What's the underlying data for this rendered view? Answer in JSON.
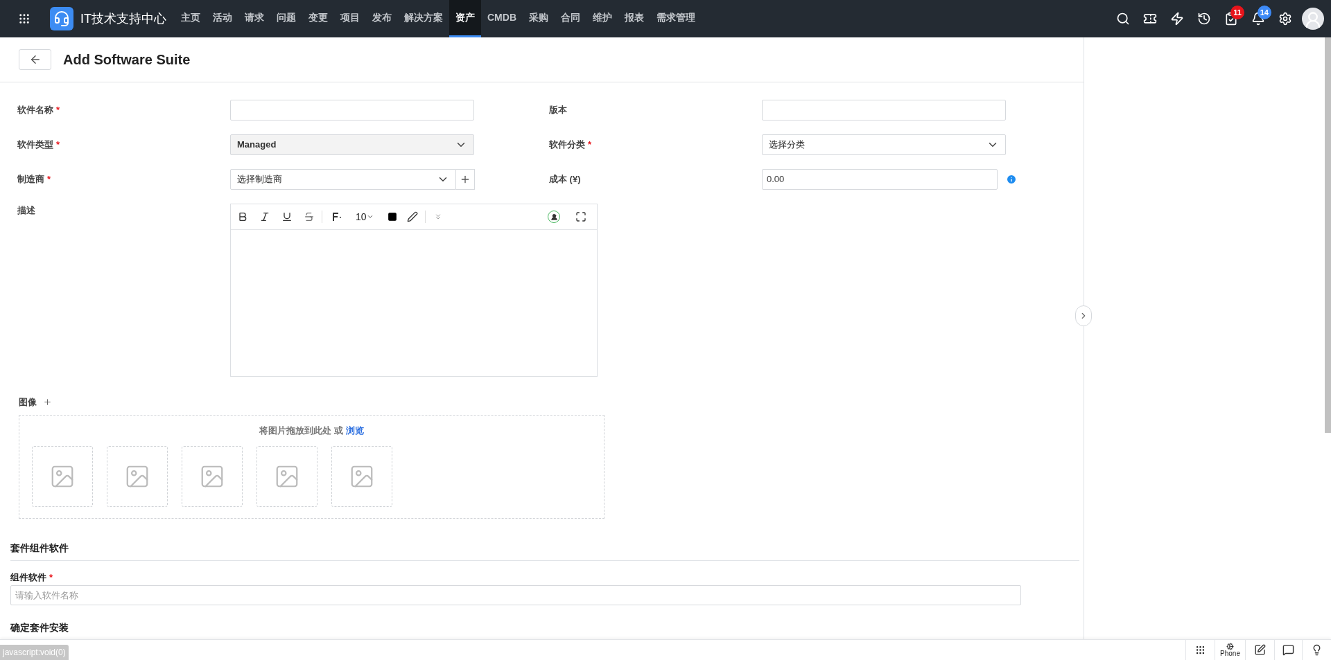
{
  "nav": {
    "brand": "IT技术支持中心",
    "items": [
      {
        "label": "主页",
        "selected": false
      },
      {
        "label": "活动",
        "selected": false
      },
      {
        "label": "请求",
        "selected": false
      },
      {
        "label": "问题",
        "selected": false
      },
      {
        "label": "变更",
        "selected": false
      },
      {
        "label": "项目",
        "selected": false
      },
      {
        "label": "发布",
        "selected": false
      },
      {
        "label": "解决方案",
        "selected": false
      },
      {
        "label": "资产",
        "selected": true
      },
      {
        "label": "CMDB",
        "selected": false
      },
      {
        "label": "采购",
        "selected": false
      },
      {
        "label": "合同",
        "selected": false
      },
      {
        "label": "维护",
        "selected": false
      },
      {
        "label": "报表",
        "selected": false
      },
      {
        "label": "需求管理",
        "selected": false
      }
    ],
    "tools": [
      {
        "kind": "search"
      },
      {
        "kind": "ticket"
      },
      {
        "kind": "bolt"
      },
      {
        "kind": "history"
      },
      {
        "kind": "tasks",
        "badge": "11",
        "color": "#e8141b"
      },
      {
        "kind": "bell",
        "badge": "14",
        "color": "#3d8af7"
      },
      {
        "kind": "settings"
      },
      {
        "kind": "avatar"
      }
    ]
  },
  "page": {
    "title": "Add Software Suite"
  },
  "fields": [
    {
      "label": "软件名称",
      "marker": "*",
      "kind": "text"
    },
    {
      "label": "版本",
      "kind": "text"
    },
    {
      "label": "软件类型",
      "marker": "*",
      "kind": "select",
      "value": "Managed",
      "disabled": true
    },
    {
      "label": "软件分类",
      "marker": "*",
      "kind": "select",
      "value": "选择分类",
      "disabled": false
    },
    {
      "label": "制造商",
      "marker": "*",
      "kind": "select_add",
      "value": "选择制造商",
      "disabled": false
    },
    {
      "label": "成本 (¥)",
      "kind": "text_info",
      "value": "0.00"
    }
  ],
  "description": {
    "label": "描述",
    "font_size": "10"
  },
  "images": {
    "label": "图像",
    "hint": "将图片拖放到此处 或",
    "link": "浏览",
    "slots": [
      {
        "kind": "empty"
      },
      {
        "kind": "empty"
      },
      {
        "kind": "empty"
      },
      {
        "kind": "empty"
      },
      {
        "kind": "empty"
      }
    ]
  },
  "components": {
    "heading": "套件组件软件",
    "label": "组件软件",
    "marker": "*",
    "placeholder": "请输入软件名称"
  },
  "install": {
    "heading": "确定套件安装"
  },
  "bottom_bar": {
    "phone": "Phone"
  },
  "status_text": "javascript:void(0)"
}
